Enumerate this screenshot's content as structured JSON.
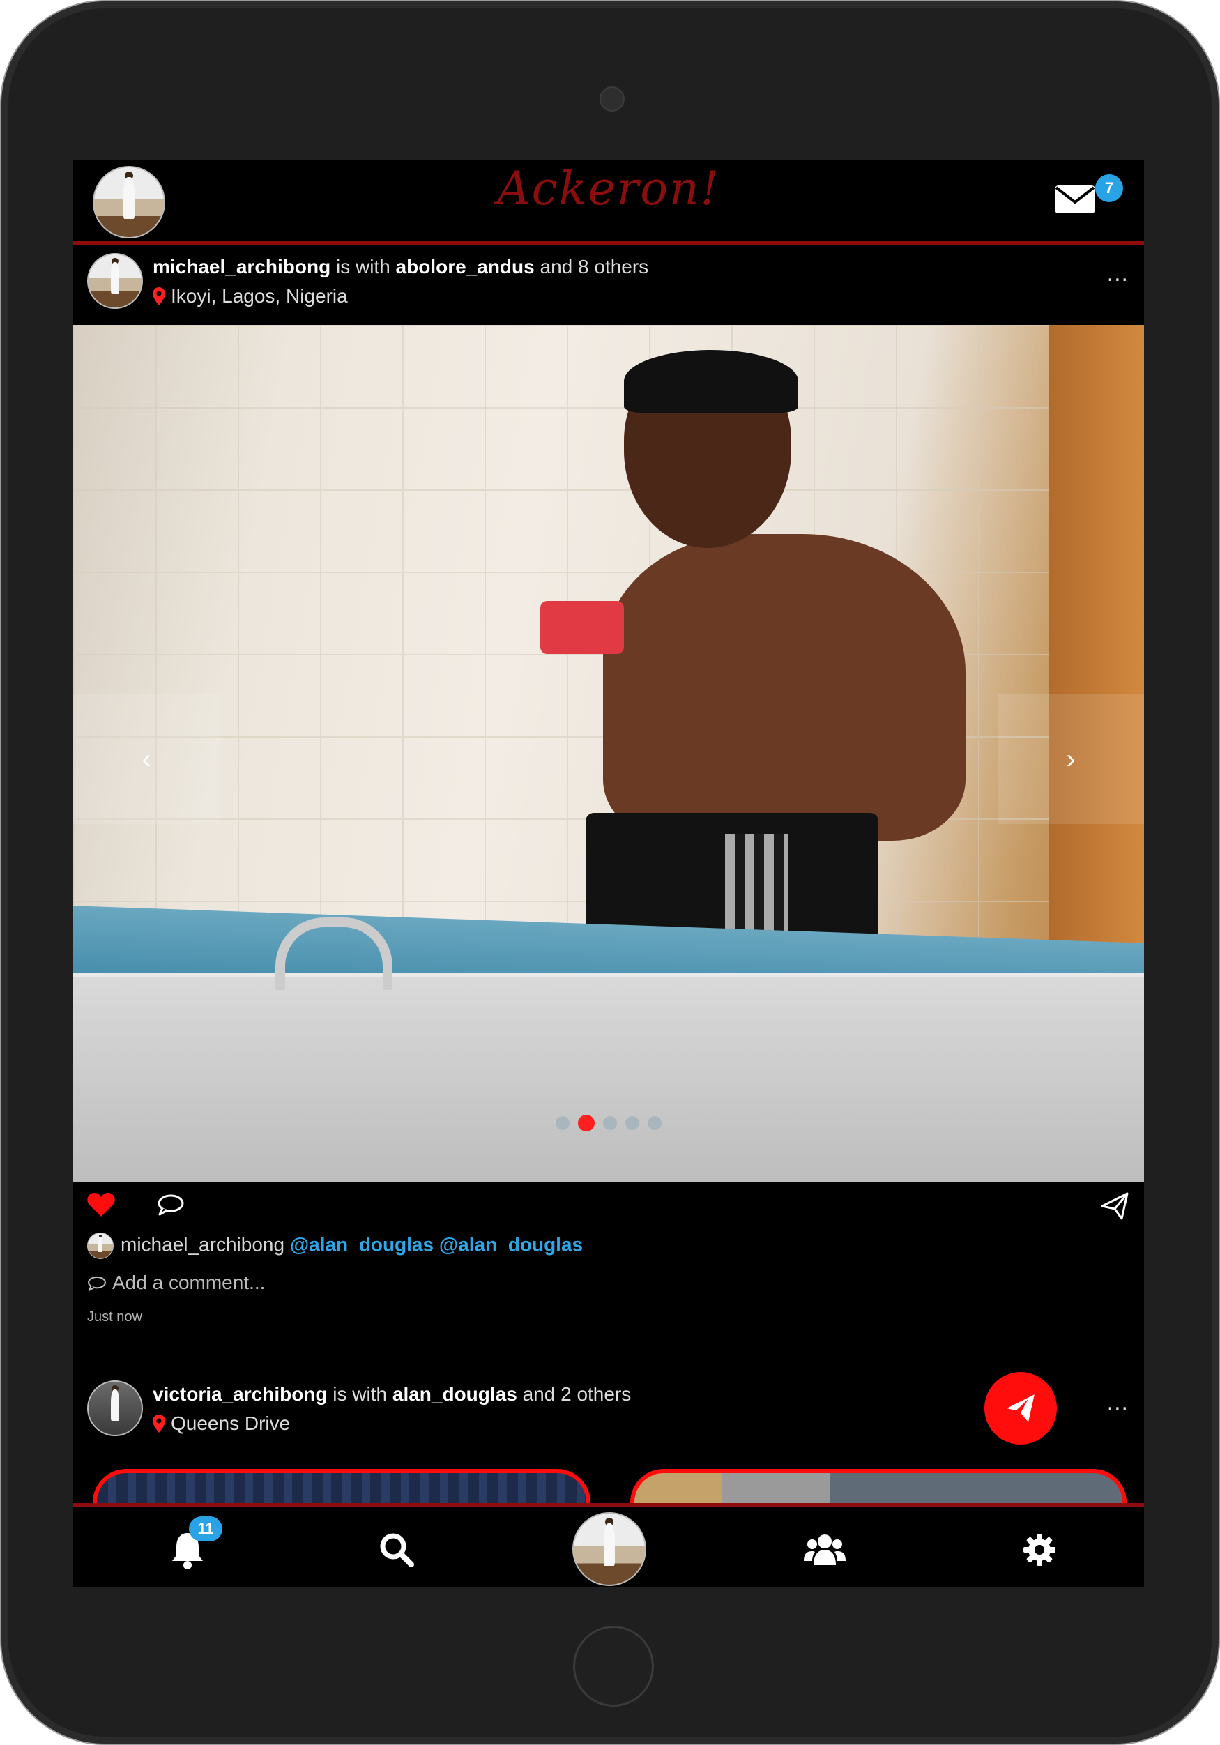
{
  "app": {
    "title": "Ackeron!",
    "messages_badge": "7",
    "accent_color": "#8e0c0c",
    "mention_color": "#2ea6e8",
    "badge_color": "#29a3e6"
  },
  "post1": {
    "username": "michael_archibong",
    "with_text": "is with",
    "tagged_user": "abolore_andus",
    "others_text": "and 8 others",
    "location": "Ikoyi, Lagos, Nigeria",
    "more": "...",
    "carousel": {
      "slides": 5,
      "active_index": 1,
      "prev": "‹",
      "next": "›"
    },
    "caption_user": "michael_archibong",
    "mentions": [
      "@alan_douglas",
      "@alan_douglas"
    ],
    "comment_placeholder": "Add a comment...",
    "timestamp": "Just now",
    "liked": true
  },
  "post2": {
    "username": "victoria_archibong",
    "with_text": "is with",
    "tagged_user": "alan_douglas",
    "others_text": "and 2 others",
    "location": "Queens Drive",
    "more": "..."
  },
  "bottom_nav": {
    "notifications_badge": "11",
    "items": [
      "bell-icon",
      "search-icon",
      "profile-avatar",
      "users-icon",
      "gear-icon"
    ]
  }
}
